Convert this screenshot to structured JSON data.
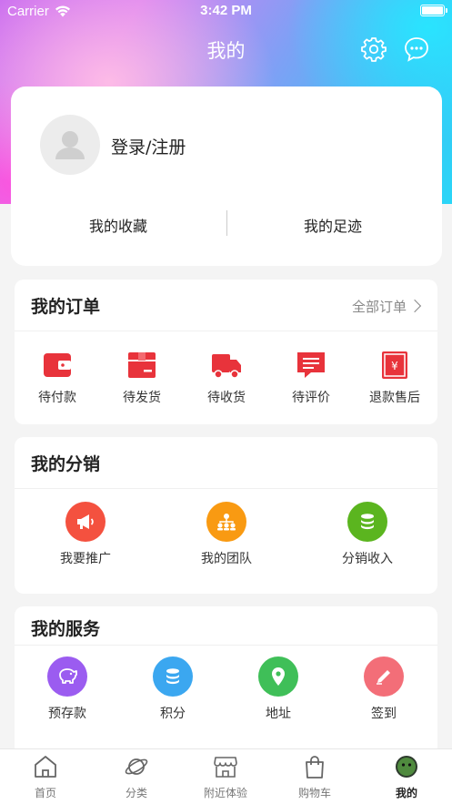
{
  "status_bar": {
    "carrier": "Carrier",
    "time": "3:42 PM"
  },
  "nav": {
    "title": "我的",
    "settings_icon": "gear-icon",
    "message_icon": "chat-bubble-icon"
  },
  "profile": {
    "login_label": "登录/注册",
    "favorites_label": "我的收藏",
    "footprints_label": "我的足迹"
  },
  "orders": {
    "title": "我的订单",
    "all_label": "全部订单",
    "accent_color": "#e8333b",
    "items": [
      {
        "label": "待付款",
        "icon": "wallet-icon"
      },
      {
        "label": "待发货",
        "icon": "package-icon"
      },
      {
        "label": "待收货",
        "icon": "truck-icon"
      },
      {
        "label": "待评价",
        "icon": "comment-icon"
      },
      {
        "label": "退款售后",
        "icon": "refund-icon"
      }
    ]
  },
  "distribution": {
    "title": "我的分销",
    "items": [
      {
        "label": "我要推广",
        "icon": "megaphone-icon",
        "color": "#f4513f"
      },
      {
        "label": "我的团队",
        "icon": "team-icon",
        "color": "#f99a12"
      },
      {
        "label": "分销收入",
        "icon": "coins-icon",
        "color": "#5bb51f"
      }
    ]
  },
  "services": {
    "title": "我的服务",
    "items": [
      {
        "label": "预存款",
        "icon": "piggy-bank-icon",
        "color": "#9b5cf0"
      },
      {
        "label": "积分",
        "icon": "points-icon",
        "color": "#3ba7f0"
      },
      {
        "label": "地址",
        "icon": "location-pin-icon",
        "color": "#3fbf58"
      },
      {
        "label": "签到",
        "icon": "pencil-icon",
        "color": "#f36e78"
      }
    ]
  },
  "tabbar": {
    "items": [
      {
        "label": "首页",
        "icon": "home-icon",
        "active": false
      },
      {
        "label": "分类",
        "icon": "planet-icon",
        "active": false
      },
      {
        "label": "附近体验",
        "icon": "store-icon",
        "active": false
      },
      {
        "label": "购物车",
        "icon": "shopping-bag-icon",
        "active": false
      },
      {
        "label": "我的",
        "icon": "profile-avatar-icon",
        "active": true
      }
    ]
  }
}
